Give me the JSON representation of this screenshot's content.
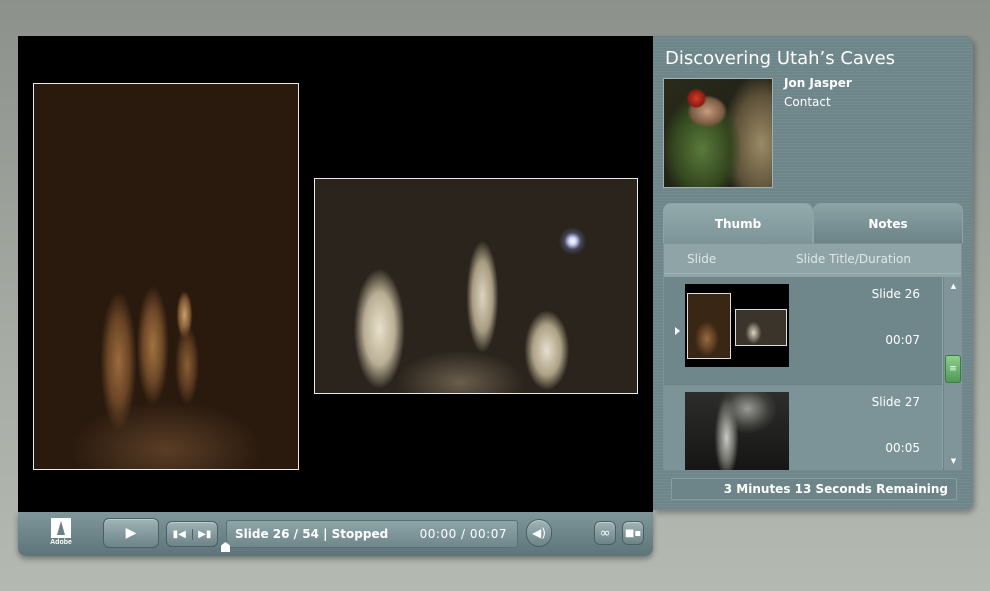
{
  "presentation": {
    "title": "Discovering Utah’s Caves",
    "presenter_name": "Jon Jasper",
    "contact_label": "Contact"
  },
  "tabs": [
    {
      "label": "Thumb",
      "active": true
    },
    {
      "label": "Notes",
      "active": false
    }
  ],
  "slide_list": {
    "headers": [
      "Slide",
      "Slide Title/Duration"
    ],
    "items": [
      {
        "title": "Slide 26",
        "duration": "00:07",
        "selected": true
      },
      {
        "title": "Slide 27",
        "duration": "00:05",
        "selected": false
      }
    ]
  },
  "time_remaining": "3 Minutes 13 Seconds Remaining",
  "controlbar": {
    "logo_text": "Adobe",
    "status": "Slide 26 / 54 | Stopped",
    "time": "00:00 / 00:07",
    "play_icon": "play-icon",
    "prev_icon": "previous-slide-icon",
    "next_icon": "next-slide-icon",
    "audio_icon": "volume-icon",
    "attach_icon": "attachment-icon",
    "layout_icon": "layout-icon"
  },
  "colors": {
    "panel": "#6e8589",
    "stage": "#000000",
    "scroll_thumb": "#5fae64"
  }
}
